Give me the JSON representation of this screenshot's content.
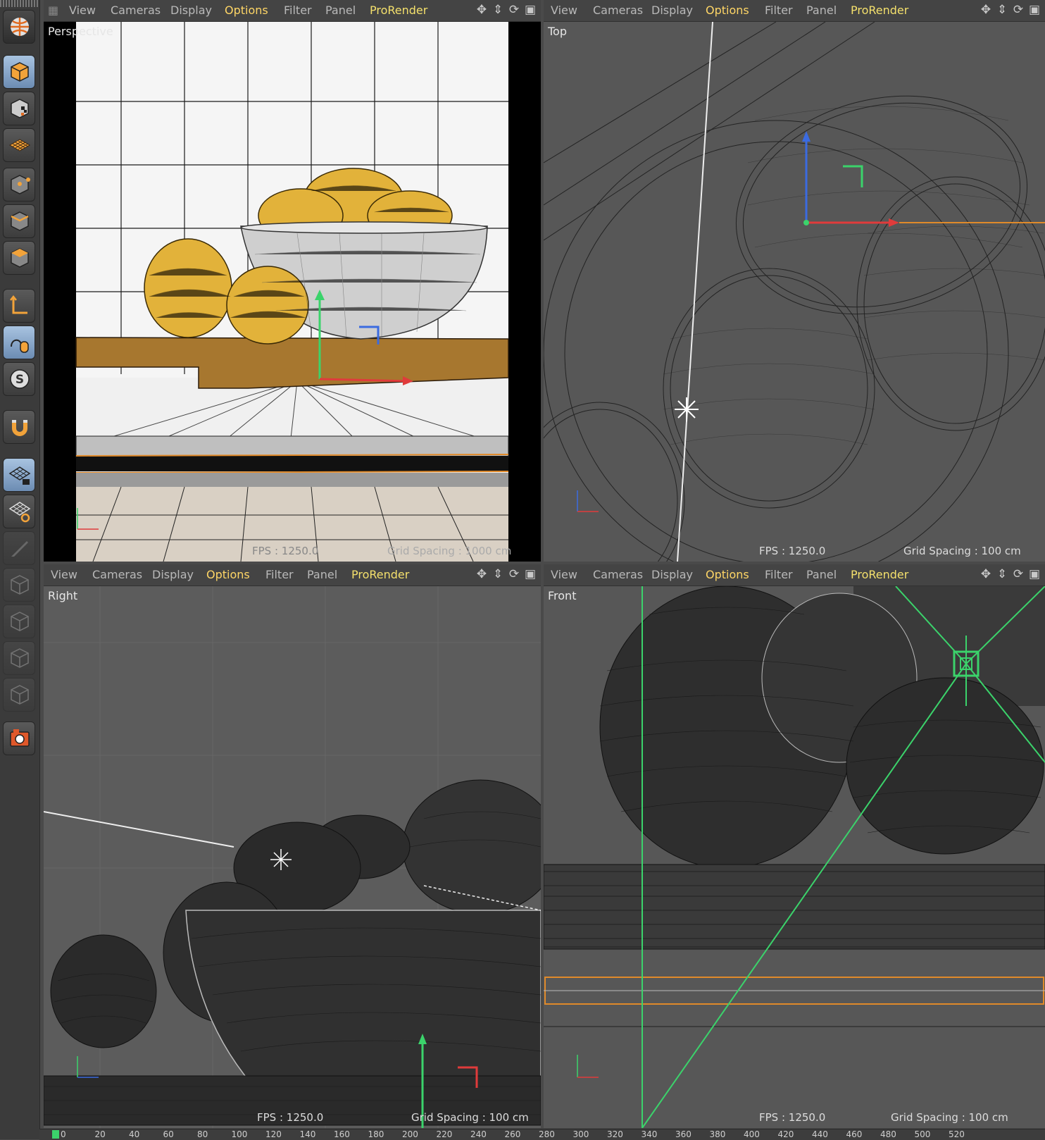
{
  "menu": {
    "view": "View",
    "cameras": "Cameras",
    "display": "Display",
    "options": "Options",
    "filter": "Filter",
    "panel": "Panel",
    "prorender": "ProRender"
  },
  "viewports": {
    "perspective": {
      "label": "Perspective",
      "fps": "FPS : 1250.0",
      "grid": "Grid Spacing : 1000 cm"
    },
    "top": {
      "label": "Top",
      "fps": "FPS : 1250.0",
      "grid": "Grid Spacing : 100 cm"
    },
    "right": {
      "label": "Right",
      "fps": "FPS : 1250.0",
      "grid": "Grid Spacing : 100 cm"
    },
    "front": {
      "label": "Front",
      "fps": "FPS : 1250.0",
      "grid": "Grid Spacing : 100 cm"
    }
  },
  "toolbar": {
    "tools": [
      "cube-icon",
      "checker-cube-icon",
      "grid-plane-icon",
      "points-mode-icon",
      "edges-mode-icon",
      "polygons-mode-icon",
      "axis-icon",
      "tweak-mode-icon",
      "solo-icon",
      "magnet-icon",
      "locked-workplane-icon",
      "workplane-icon",
      "knife-icon",
      "camera-icon",
      "cube-outline-icon",
      "cube-outline-icon",
      "cube-outline-icon",
      "render-icon"
    ]
  },
  "timeline": {
    "ticks": [
      "0",
      "20",
      "40",
      "60",
      "80",
      "100",
      "120",
      "140",
      "160",
      "180",
      "200",
      "220",
      "240",
      "260",
      "280",
      "300",
      "320",
      "340",
      "360",
      "380",
      "400",
      "420",
      "440",
      "460",
      "480",
      "500",
      "520"
    ]
  },
  "colors": {
    "accent": "#f4e06c",
    "options": "#ffd666",
    "lemon": "#e2b23a",
    "selection": "#e08a2a",
    "axis_x": "#e03b3b",
    "axis_y": "#3bd36b",
    "axis_z": "#3b6be0"
  }
}
